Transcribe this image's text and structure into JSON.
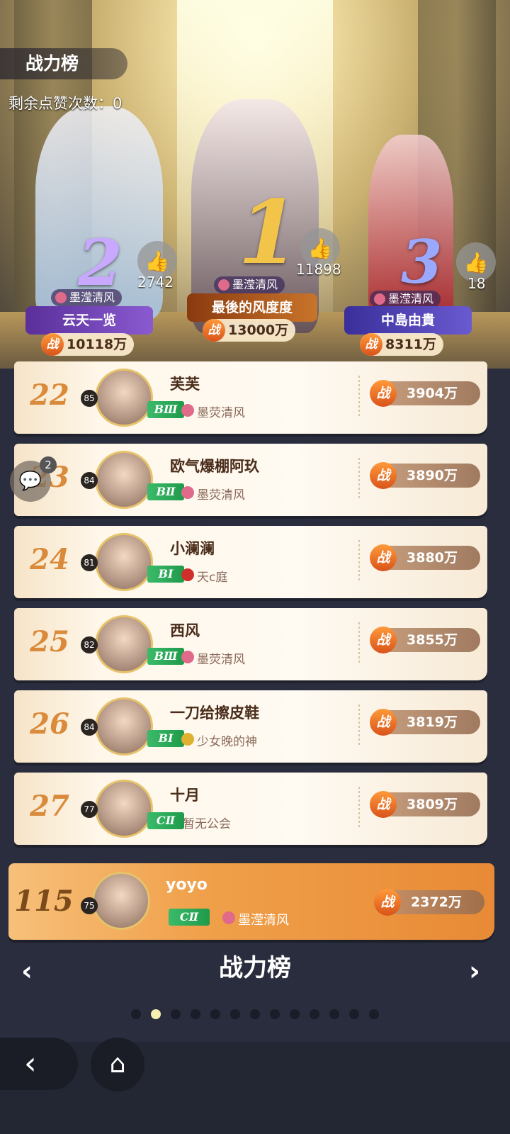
{
  "header": {
    "title": "战力榜",
    "likes_remaining": "剩余点赞次数：0"
  },
  "podium": [
    {
      "rank": "2",
      "likes": "2742",
      "guild": "墨滢清风",
      "name": "云天一览",
      "power": "10118万",
      "banner_color": "#6a3fb0"
    },
    {
      "rank": "1",
      "likes": "11898",
      "guild": "墨滢清风",
      "name": "最後的风度度",
      "power": "13000万",
      "banner_color": "#b0622a"
    },
    {
      "rank": "3",
      "likes": "18",
      "guild": "墨滢清风",
      "name": "中島由貴",
      "power": "8311万",
      "banner_color": "#4a3fb0"
    }
  ],
  "power_icon": "战",
  "rows": [
    {
      "rank": "22",
      "level": "85",
      "name": "芙芙",
      "tier": "BⅢ",
      "guild": "墨荧清风",
      "power": "3904万"
    },
    {
      "rank": "23",
      "level": "84",
      "name": "欧气爆棚阿玖",
      "tier": "BⅡ",
      "guild": "墨荧清风",
      "power": "3890万"
    },
    {
      "rank": "24",
      "level": "81",
      "name": "小澜澜",
      "tier": "BⅠ",
      "guild": "天c庭",
      "power": "3880万"
    },
    {
      "rank": "25",
      "level": "82",
      "name": "西风",
      "tier": "BⅢ",
      "guild": "墨荧清风",
      "power": "3855万"
    },
    {
      "rank": "26",
      "level": "84",
      "name": "一刀给擦皮鞋",
      "tier": "BⅠ",
      "guild": "少女晚的神",
      "power": "3819万"
    },
    {
      "rank": "27",
      "level": "77",
      "name": "十月",
      "tier": "CⅡ",
      "guild": "暂无公会",
      "power": "3809万"
    }
  ],
  "me": {
    "rank": "115",
    "level": "75",
    "name": "yoyo",
    "tier": "CⅡ",
    "guild": "墨滢清风",
    "power": "2372万"
  },
  "chat": {
    "badge": "2"
  },
  "footer": {
    "title": "战力榜",
    "page_count": 13,
    "active_page": 2
  },
  "icons": {
    "like": "thumbs-up-icon",
    "chat": "chat-bubble-icon",
    "back": "back-arrow-icon",
    "home": "home-icon"
  }
}
